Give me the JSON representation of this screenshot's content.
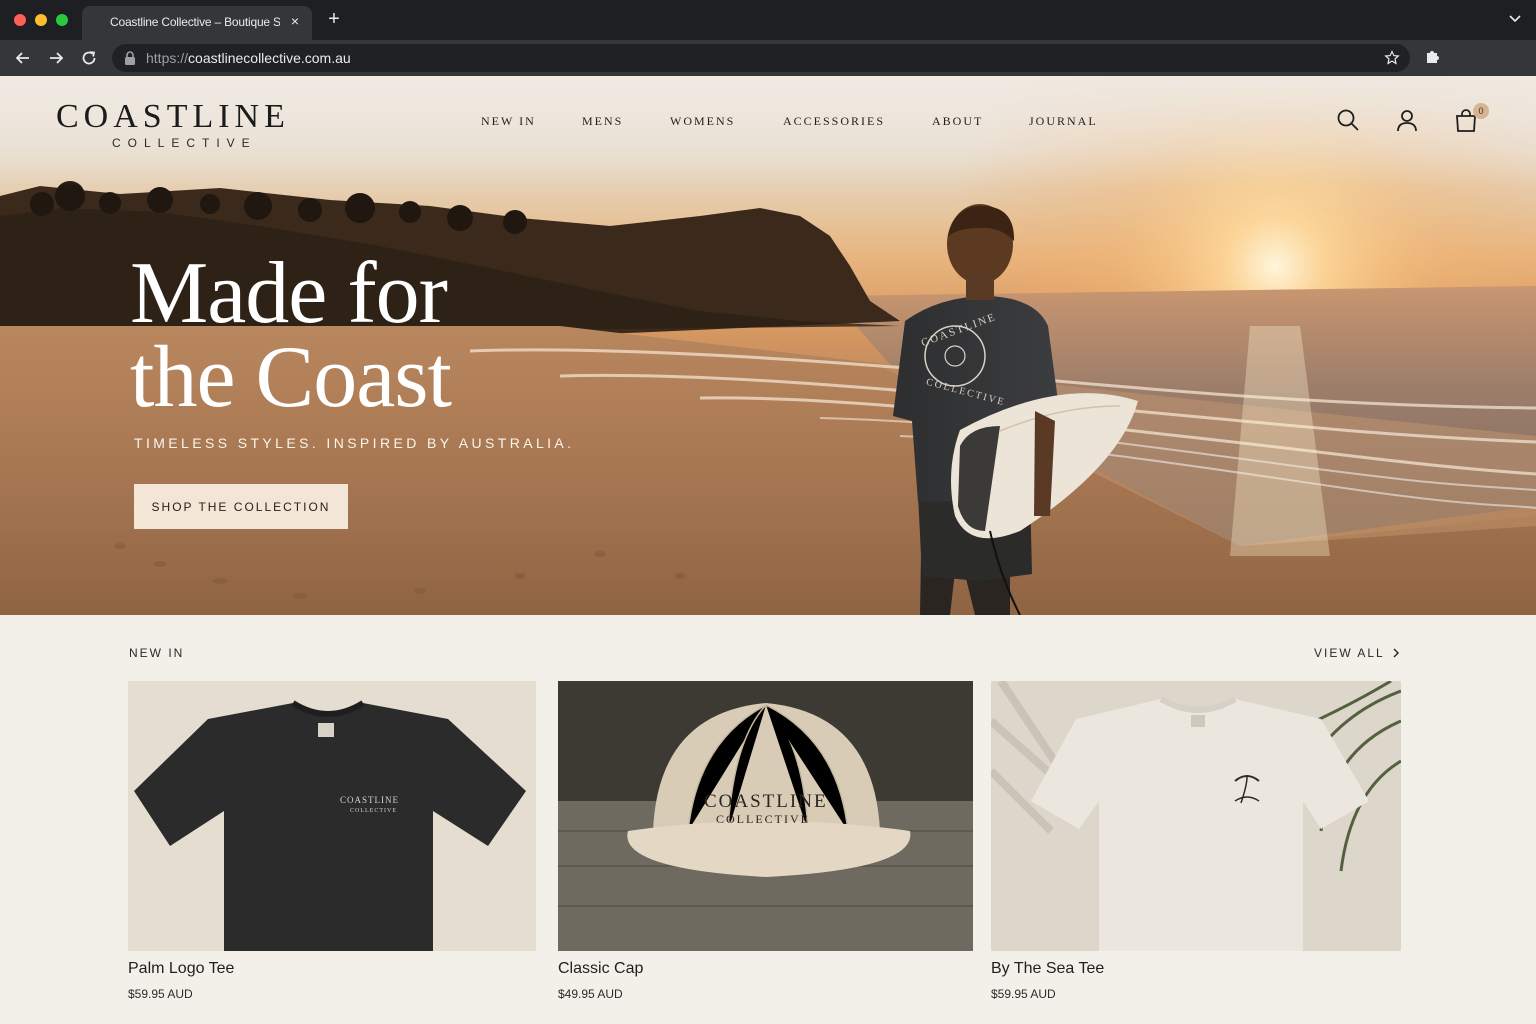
{
  "browser": {
    "tab_title": "Coastline Collective – Boutique Surf",
    "url_protocol": "https://",
    "url_domain": "coastlinecollective.com.au",
    "icons": [
      "close-icon",
      "plus-icon",
      "chevron-down-icon",
      "back-arrow-icon",
      "forward-arrow-icon",
      "reload-icon",
      "lock-icon",
      "star-icon",
      "puzzle-icon"
    ]
  },
  "header": {
    "logo_main": "COASTLINE",
    "logo_sub": "COLLECTIVE",
    "nav": [
      "NEW IN",
      "MENS",
      "WOMENS",
      "ACCESSORIES",
      "ABOUT",
      "JOURNAL"
    ],
    "cart_count": "0",
    "icons": [
      "search-icon",
      "account-icon",
      "bag-icon"
    ]
  },
  "hero": {
    "headline_line1": "Made for",
    "headline_line2": "the Coast",
    "tagline": "TIMELESS STYLES. INSPIRED BY AUSTRALIA.",
    "cta_label": "SHOP THE COLLECTION",
    "shirt_print_top": "COASTLINE",
    "shirt_print_bottom": "COLLECTIVE"
  },
  "new_in": {
    "title": "NEW IN",
    "view_all": "VIEW ALL",
    "products": [
      {
        "name": "Palm Logo Tee",
        "price": "$59.95 AUD",
        "print_top": "COASTLINE",
        "print_bottom": "COLLECTIVE"
      },
      {
        "name": "Classic Cap",
        "price": "$49.95 AUD",
        "print_top": "COASTLINE",
        "print_bottom": "COLLECTIVE"
      },
      {
        "name": "By The Sea Tee",
        "price": "$59.95 AUD"
      }
    ]
  },
  "colors": {
    "chrome_dark": "#1e1f22",
    "chrome_toolbar": "#35363a",
    "page_bg": "#f3efe9",
    "cta_bg": "#f3e6d6",
    "text_dark": "#1f1f1f",
    "badge": "#d6b594"
  }
}
